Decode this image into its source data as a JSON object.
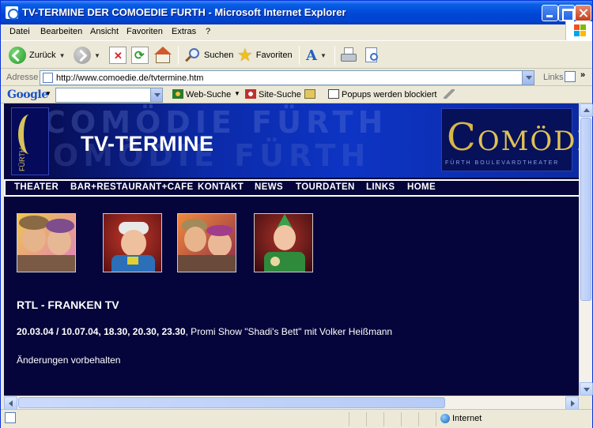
{
  "window": {
    "title": "TV-TERMINE DER COMOEDIE FURTH - Microsoft Internet Explorer"
  },
  "menu": [
    "Datei",
    "Bearbeiten",
    "Ansicht",
    "Favoriten",
    "Extras",
    "?"
  ],
  "toolbar": {
    "back_label": "Zurück",
    "search_label": "Suchen",
    "favorites_label": "Favoriten"
  },
  "address": {
    "label": "Adresse",
    "url": "http://www.comoedie.de/tvtermine.htm",
    "links_label": "Links"
  },
  "google": {
    "logo": "Google",
    "web_search": "Web-Suche",
    "site_search": "Site-Suche",
    "popups": "Popups werden blockiert"
  },
  "page": {
    "header_title": "TV-TERMINE",
    "bg_word": "COMÖDIE FÜRTH",
    "logo_right_word": "OMÖDIE",
    "logo_right_letter": "C",
    "logo_right_sub": "FÜRTH BOULEVARDTHEATER",
    "logo_left_text": "FÜRTH",
    "nav": [
      "THEATER",
      "BAR+RESTAURANT+CAFE",
      "KONTAKT",
      "NEWS",
      "TOURDATEN",
      "LINKS",
      "HOME"
    ],
    "section_title": "RTL - FRANKEN TV",
    "event_dates": "20.03.04 / 10.07.04, 18.30, 20.30, 23.30",
    "event_text": ", Promi Show \"Shadi's Bett\" mit Volker Heißmann",
    "note": "Änderungen vorbehalten"
  },
  "status": {
    "zone": "Internet"
  },
  "colors": {
    "page_bg": "#05053b",
    "header_blue": "#0d34c4",
    "logo_gold": "#e0c154",
    "xp_title": "#0047d6"
  }
}
